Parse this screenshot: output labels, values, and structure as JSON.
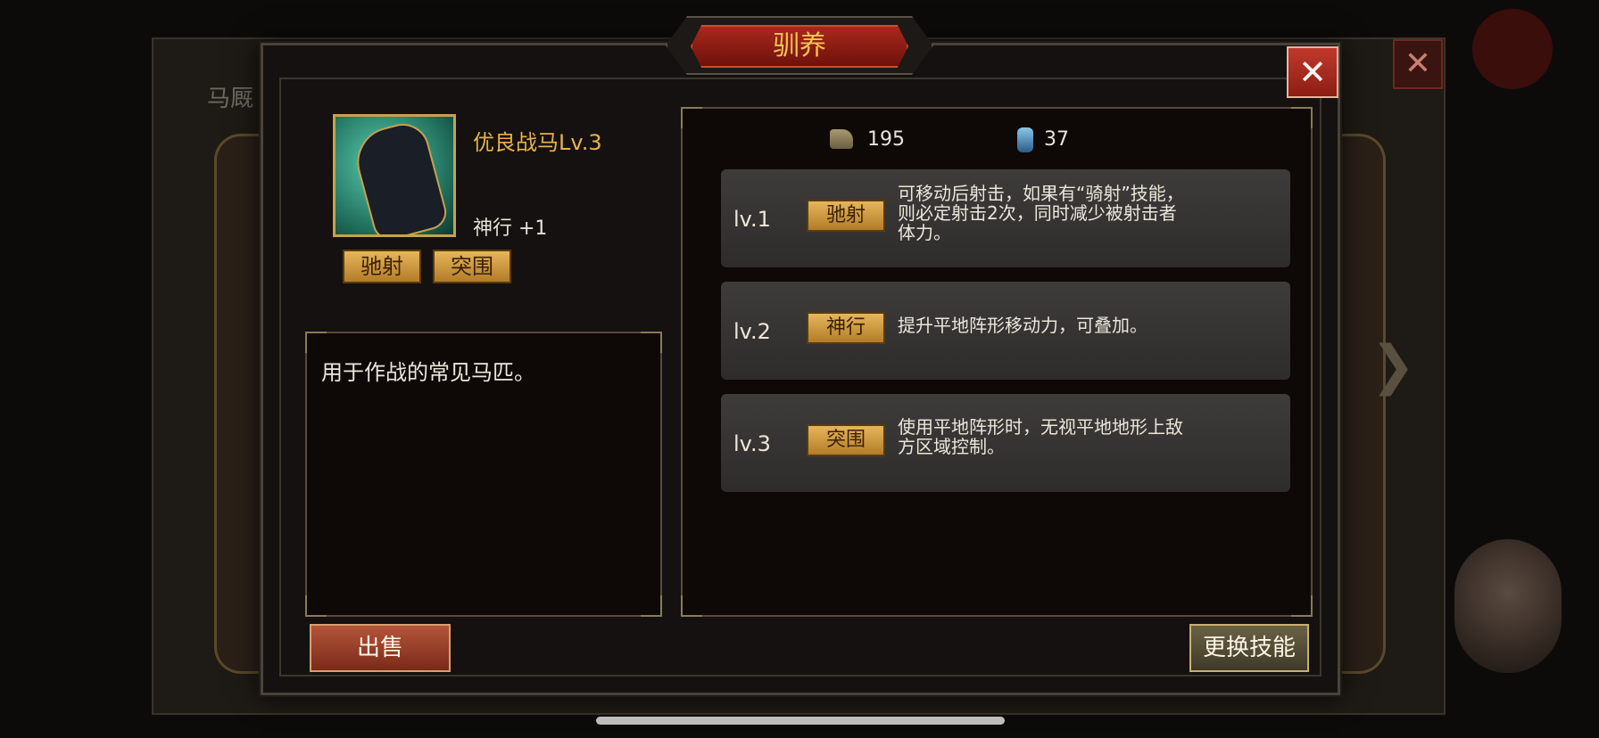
{
  "background": {
    "tab_label": "马厩",
    "close_symbol": "✕"
  },
  "dialog": {
    "title": "驯养",
    "close_symbol": "✕"
  },
  "horse": {
    "name": "优良战马Lv.3",
    "stat": "神行 +1",
    "tags": [
      "驰射",
      "突围"
    ],
    "description": "用于作战的常见马匹。"
  },
  "resources": [
    {
      "icon": "hay-icon",
      "value": "195"
    },
    {
      "icon": "lantern-icon",
      "value": "37"
    }
  ],
  "skills": [
    {
      "level": "lv.1",
      "name": "驰射",
      "lines": [
        "可移动后射击，如果有“骑射”技能，",
        "则必定射击2次，同时减少被射击者",
        "体力。"
      ]
    },
    {
      "level": "lv.2",
      "name": "神行",
      "lines": [
        "提升平地阵形移动力，可叠加。"
      ]
    },
    {
      "level": "lv.3",
      "name": "突围",
      "lines": [
        "使用平地阵形时，无视平地地形上敌",
        "方区域控制。"
      ]
    }
  ],
  "buttons": {
    "sell": "出售",
    "change_skill": "更换技能"
  },
  "colors": {
    "gold_text": "#e8b24a",
    "title_red": "#a8281c",
    "tag_gold": "#e6b65a"
  }
}
